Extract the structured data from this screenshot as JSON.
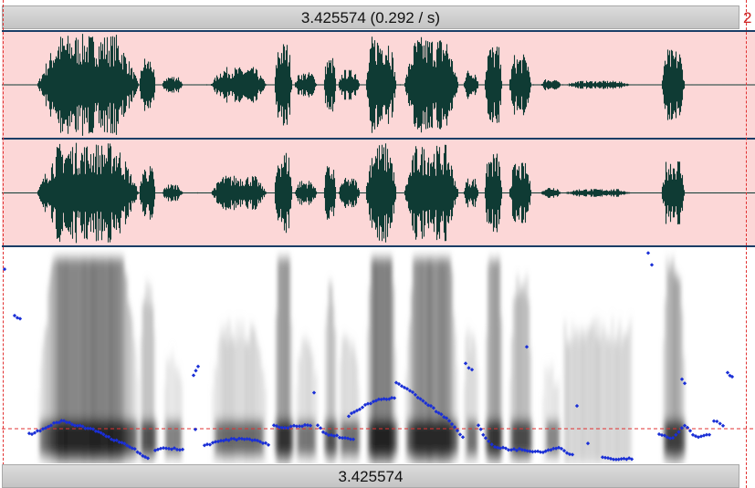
{
  "header": {
    "selection_readout": "3.425574 (0.292 / s)",
    "overflow_digit": "2"
  },
  "footer": {
    "time_readout": "3.425574"
  },
  "colors": {
    "waveform_bg": "#fcd7d7",
    "waveform": "#0f3b34",
    "pitch": "#1a2fd6",
    "cursor": "#e23030",
    "separator": "#1a3d66"
  }
}
